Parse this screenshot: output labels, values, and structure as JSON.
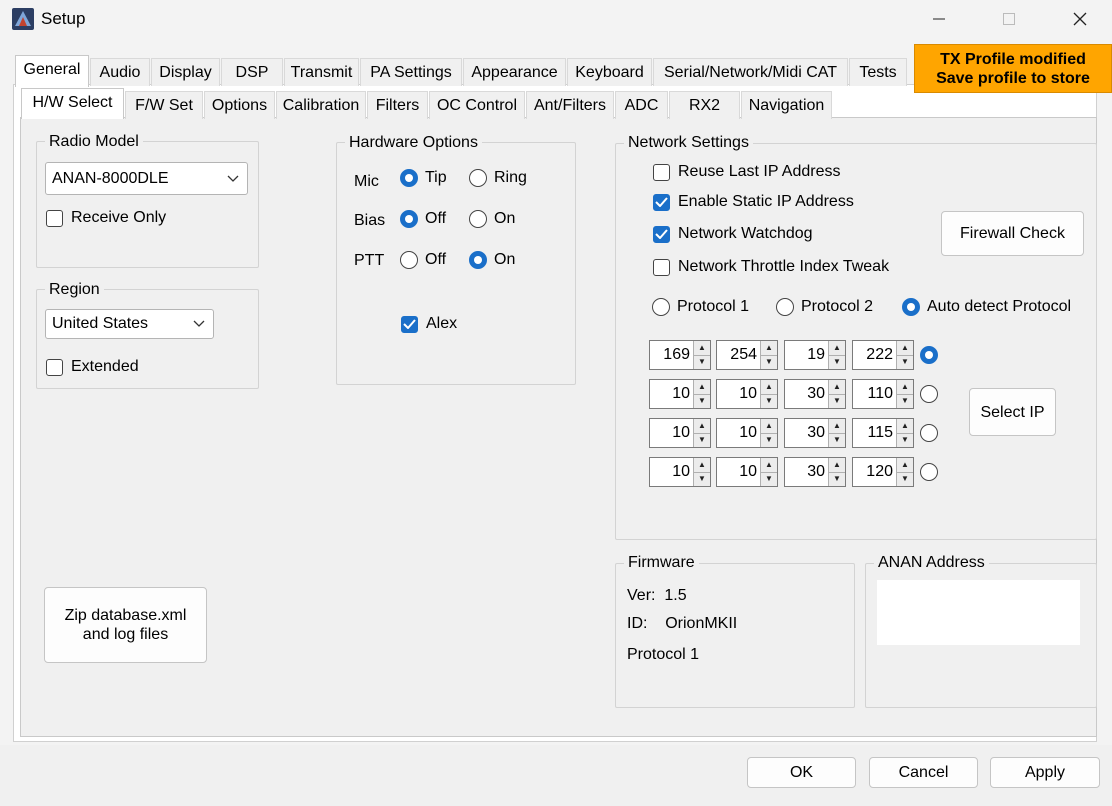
{
  "window": {
    "title": "Setup"
  },
  "tabs_main": [
    "General",
    "Audio",
    "Display",
    "DSP",
    "Transmit",
    "PA Settings",
    "Appearance",
    "Keyboard",
    "Serial/Network/Midi CAT",
    "Tests"
  ],
  "tabs_sub": [
    "H/W Select",
    "F/W Set",
    "Options",
    "Calibration",
    "Filters",
    "OC Control",
    "Ant/Filters",
    "ADC",
    "RX2",
    "Navigation"
  ],
  "banner": {
    "line1": "TX Profile modified",
    "line2": "Save profile to store",
    "color": "#ffa500"
  },
  "radio_model": {
    "legend": "Radio Model",
    "value": "ANAN-8000DLE",
    "receive_only_label": "Receive Only",
    "receive_only_checked": false
  },
  "region": {
    "legend": "Region",
    "value": "United States",
    "extended_label": "Extended",
    "extended_checked": false
  },
  "hardware": {
    "legend": "Hardware Options",
    "mic_label": "Mic",
    "mic_opt1": "Tip",
    "mic_opt2": "Ring",
    "bias_label": "Bias",
    "bias_opt1": "Off",
    "bias_opt2": "On",
    "ptt_label": "PTT",
    "ptt_opt1": "Off",
    "ptt_opt2": "On",
    "alex_label": "Alex",
    "alex_checked": true
  },
  "network": {
    "legend": "Network Settings",
    "reuse_ip": "Reuse Last IP Address",
    "static_ip": "Enable Static IP Address",
    "watchdog": "Network Watchdog",
    "throttle": "Network Throttle Index Tweak",
    "protocol1": "Protocol 1",
    "protocol2": "Protocol 2",
    "auto_protocol": "Auto detect Protocol",
    "firewall_button": "Firewall Check",
    "select_ip_button": "Select IP",
    "ip_rows": [
      [
        "169",
        "254",
        "19",
        "222"
      ],
      [
        "10",
        "10",
        "30",
        "110"
      ],
      [
        "10",
        "10",
        "30",
        "115"
      ],
      [
        "10",
        "10",
        "30",
        "120"
      ]
    ]
  },
  "firmware": {
    "legend": "Firmware",
    "ver": "Ver:  1.5",
    "id": "ID:    OrionMKII",
    "protocol": "Protocol 1"
  },
  "anan_address": {
    "legend": "ANAN Address"
  },
  "zip_button": {
    "line1": "Zip database.xml",
    "line2": "and log files"
  },
  "footer": {
    "ok": "OK",
    "cancel": "Cancel",
    "apply": "Apply"
  }
}
